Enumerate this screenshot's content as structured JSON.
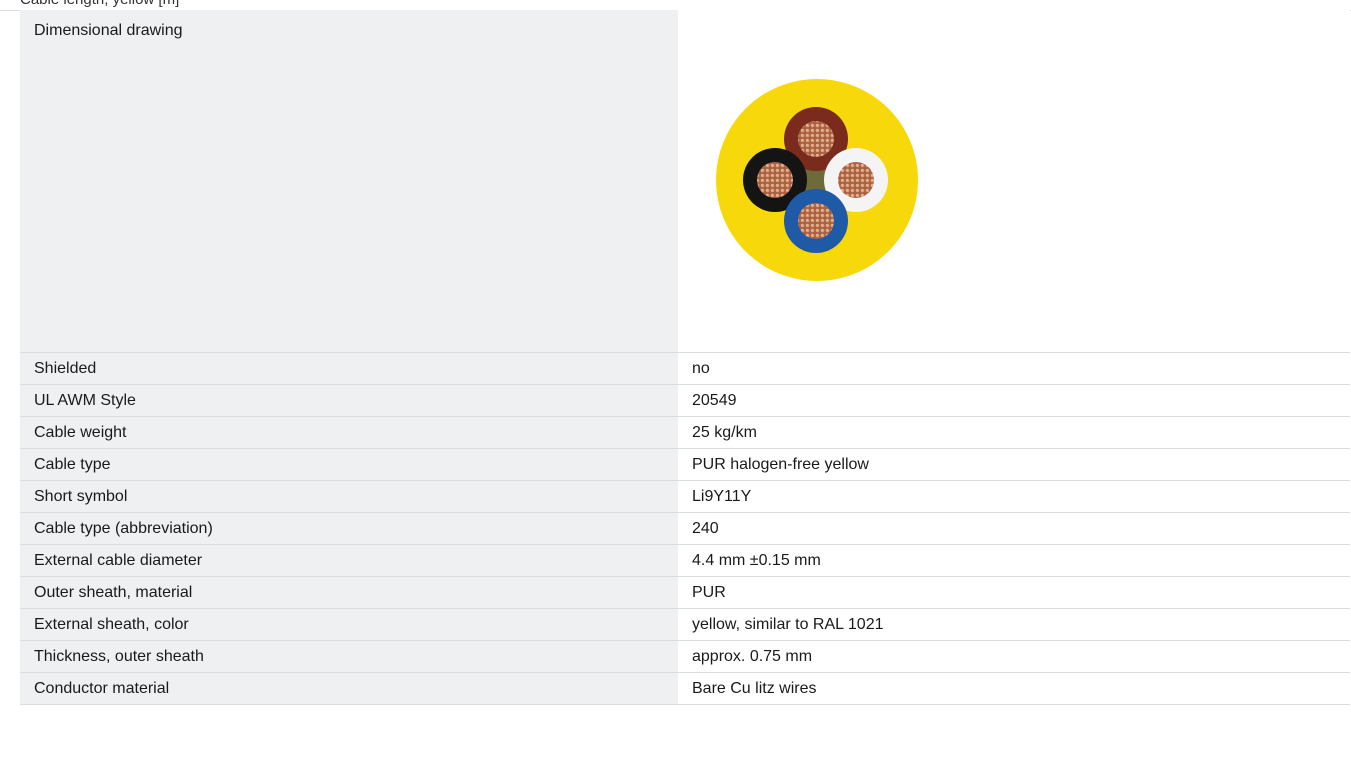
{
  "header": {
    "text": "Cable length; yellow [m]"
  },
  "drawing": {
    "label": "Dimensional drawing",
    "sheath_color": "#f7d90b",
    "core_colors": [
      "#7b2b1d",
      "#141414",
      "#f4f4f4",
      "#1f5aa6"
    ],
    "conductor_color": "#b06e4d",
    "filler_color": "#6d6b3a"
  },
  "specs": [
    {
      "label": "Shielded",
      "value": "no"
    },
    {
      "label": "UL AWM Style",
      "value": "20549"
    },
    {
      "label": "Cable weight",
      "value": "25 kg/km"
    },
    {
      "label": "Cable type",
      "value": "PUR halogen-free yellow"
    },
    {
      "label": "Short symbol",
      "value": "Li9Y11Y"
    },
    {
      "label": "Cable type (abbreviation)",
      "value": "240"
    },
    {
      "label": "External cable diameter",
      "value": "4.4 mm ±0.15 mm"
    },
    {
      "label": "Outer sheath, material",
      "value": "PUR"
    },
    {
      "label": "External sheath, color",
      "value": "yellow, similar to RAL 1021"
    },
    {
      "label": "Thickness, outer sheath",
      "value": "approx. 0.75 mm"
    },
    {
      "label": "Conductor material",
      "value": "Bare Cu litz wires"
    }
  ]
}
